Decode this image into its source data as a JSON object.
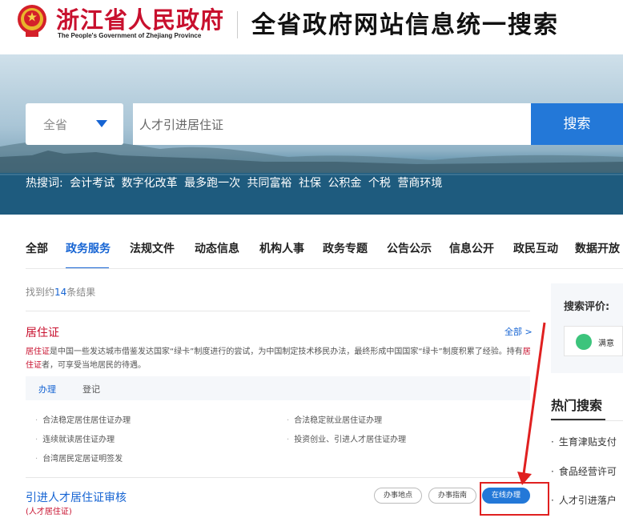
{
  "header": {
    "province_name": "浙江省人民政府",
    "province_en": "The People's Government of Zhejiang Province",
    "site_title": "全省政府网站信息统一搜索"
  },
  "search": {
    "scope": "全省",
    "query": "人才引进居住证",
    "button": "搜索",
    "hot_label": "热搜词:",
    "hot_terms": [
      "会计考试",
      "数字化改革",
      "最多跑一次",
      "共同富裕",
      "社保",
      "公积金",
      "个税",
      "营商环境"
    ]
  },
  "tabs": [
    "全部",
    "政务服务",
    "法规文件",
    "动态信息",
    "机构人事",
    "政务专题",
    "公告公示",
    "信息公开",
    "政民互动",
    "数据开放"
  ],
  "active_tab": "政务服务",
  "results_summary": {
    "prefix": "找到约",
    "count": "14",
    "suffix": "条结果"
  },
  "result1": {
    "title": "居住证",
    "all_link": "全部 >",
    "desc_hl": "居住证",
    "desc_1": "是中国一些发达城市借鉴发达国家“绿卡”制度进行的尝试，为中国制定技术移民办法，最终形成中国国家“绿卡”制度积累了经验。持有",
    "desc_hl2": "居住证",
    "desc_2": "者，可享受当地居民的待遇。",
    "subtabs": [
      "办理",
      "登记"
    ],
    "links": [
      "合法稳定居住居住证办理",
      "合法稳定就业居住证办理",
      "连续就读居住证办理",
      "投资创业、引进人才居住证办理",
      "台湾居民定居证明签发"
    ]
  },
  "result2": {
    "title": "引进人才居住证审核",
    "sub_prefix": "(人才",
    "sub_hl": "居住证",
    "sub_suffix": ")",
    "buttons": [
      "办事地点",
      "办事指南",
      "在线办理"
    ]
  },
  "sidebar": {
    "eval_title": "搜索评价:",
    "eval_option": "满意",
    "hot_title": "热门搜索",
    "hot_items": [
      "生育津贴支付",
      "食品经营许可",
      "人才引进落户"
    ]
  },
  "colors": {
    "brand_red": "#c8102e",
    "accent_blue": "#1664d3",
    "highlight_box": "#e02020"
  }
}
